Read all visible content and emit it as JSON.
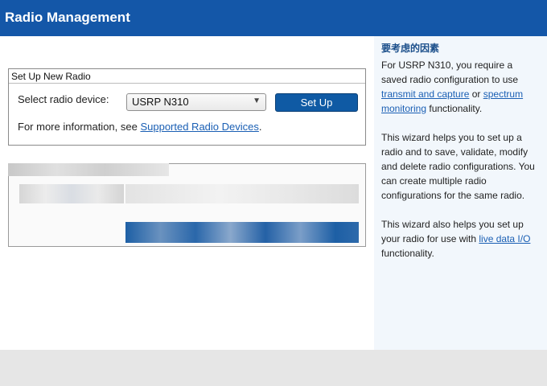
{
  "app": {
    "title": "Radio Management"
  },
  "setup_panel": {
    "title": "Set Up New Radio",
    "device_label": "Select radio device:",
    "device_value": "USRP N310",
    "setup_button": "Set Up",
    "info_prefix": "For more information, see ",
    "info_link": "Supported Radio Devices",
    "info_suffix": "."
  },
  "sidebar": {
    "title": "要考虑的因素",
    "p1": {
      "t1": "For USRP N310, you require a saved radio configuration to use ",
      "link1": "transmit and capture",
      "t2": " or ",
      "link2": "spectrum monitoring",
      "t3": " functionality."
    },
    "p2": "This wizard helps you to set up a radio and to save, validate, modify and delete radio configurations. You can create multiple radio configurations for the same radio.",
    "p3": {
      "t1": "This wizard also helps you set up your radio for use with ",
      "link1": "live data I/O",
      "t2": " functionality."
    }
  },
  "colors": {
    "header": "#1457a8",
    "button": "#0f5aa4",
    "link": "#1a5fb4",
    "sidebar_bg": "#f2f7fc"
  }
}
